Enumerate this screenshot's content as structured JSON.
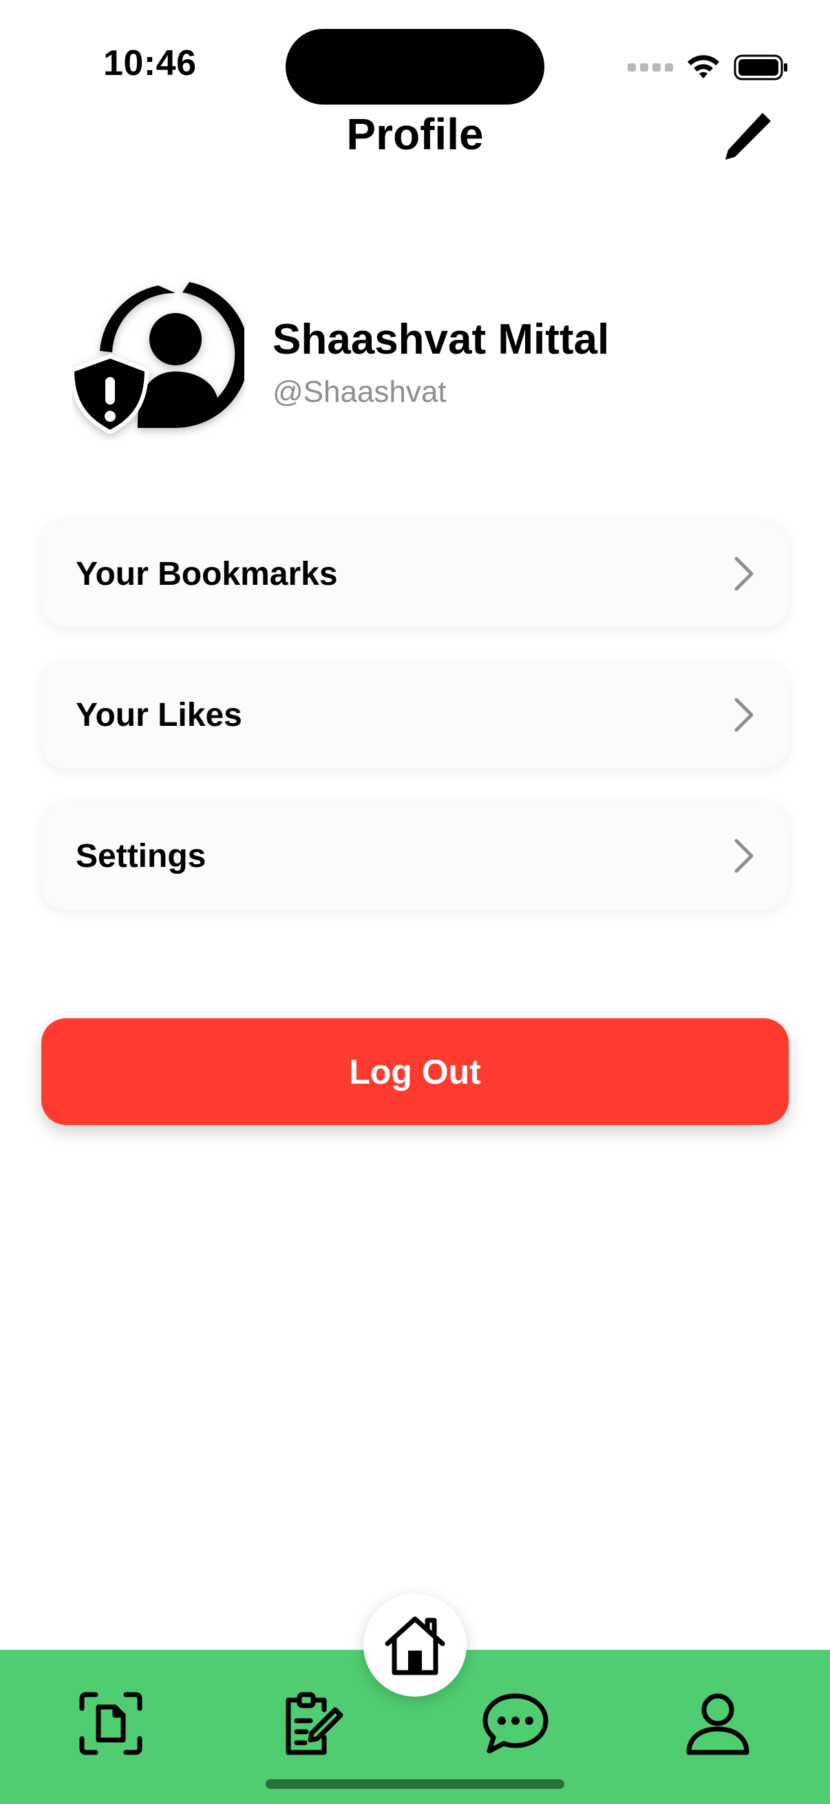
{
  "status_bar": {
    "time": "10:46"
  },
  "header": {
    "title": "Profile",
    "edit_icon": "pencil-icon"
  },
  "profile": {
    "name": "Shaashvat Mittal",
    "handle": "@Shaashvat",
    "avatar_icon": "person-warning-icon"
  },
  "menu": {
    "items": [
      {
        "label": "Your Bookmarks"
      },
      {
        "label": "Your Likes"
      },
      {
        "label": "Settings"
      }
    ]
  },
  "logout": {
    "label": "Log Out",
    "color": "#ff3b30"
  },
  "tabbar": {
    "color": "#50cd70",
    "tabs": [
      {
        "icon": "document-scan-icon"
      },
      {
        "icon": "clipboard-edit-icon"
      },
      {
        "icon": "home-icon"
      },
      {
        "icon": "chat-bubble-icon"
      },
      {
        "icon": "person-icon"
      }
    ]
  }
}
